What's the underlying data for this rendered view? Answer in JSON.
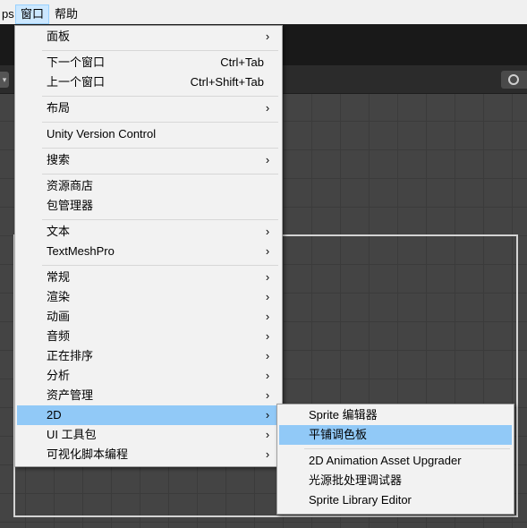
{
  "menubar": {
    "items": [
      {
        "label": "ps"
      },
      {
        "label": "窗口"
      },
      {
        "label": "帮助"
      }
    ]
  },
  "window_menu": {
    "items": [
      {
        "label": "面板",
        "arrow": "›"
      },
      {
        "label": "下一个窗口",
        "shortcut": "Ctrl+Tab"
      },
      {
        "label": "上一个窗口",
        "shortcut": "Ctrl+Shift+Tab"
      },
      {
        "label": "布局",
        "arrow": "›"
      },
      {
        "label": "Unity Version Control"
      },
      {
        "label": "搜索",
        "arrow": "›"
      },
      {
        "label": "资源商店"
      },
      {
        "label": "包管理器"
      },
      {
        "label": "文本",
        "arrow": "›"
      },
      {
        "label": "TextMeshPro",
        "arrow": "›"
      },
      {
        "label": "常规",
        "arrow": "›"
      },
      {
        "label": "渲染",
        "arrow": "›"
      },
      {
        "label": "动画",
        "arrow": "›"
      },
      {
        "label": "音频",
        "arrow": "›"
      },
      {
        "label": "正在排序",
        "arrow": "›"
      },
      {
        "label": "分析",
        "arrow": "›"
      },
      {
        "label": "资产管理",
        "arrow": "›"
      },
      {
        "label": "2D",
        "arrow": "›",
        "highlighted": true
      },
      {
        "label": "UI 工具包",
        "arrow": "›"
      },
      {
        "label": "可视化脚本编程",
        "arrow": "›"
      }
    ]
  },
  "submenu_2d": {
    "items": [
      {
        "label": "Sprite 编辑器"
      },
      {
        "label": "平铺调色板",
        "highlighted": true
      },
      {
        "label": "2D Animation Asset Upgrader"
      },
      {
        "label": "光源批处理调试器"
      },
      {
        "label": "Sprite Library Editor"
      }
    ]
  },
  "colors": {
    "highlight": "#91c9f7",
    "menu_bg": "#f2f2f2",
    "scene_bg": "#444444",
    "toolbar_bg": "#191919"
  },
  "icons": {
    "submenu_arrow": "chevron-right-icon",
    "scene_dropdown": "chevron-down-icon",
    "scene_toggle": "circle-icon"
  }
}
